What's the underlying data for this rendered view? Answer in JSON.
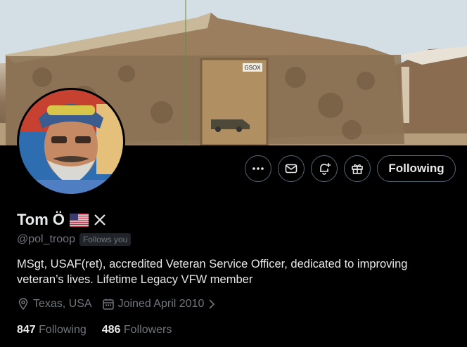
{
  "profile": {
    "name": "Tom Ö",
    "flag_icon": "us-flag-icon",
    "badge_icon": "x-logo-icon",
    "handle": "@pol_troop",
    "follows_you": "Follows you",
    "bio": "MSgt, USAF(ret), accredited Veteran Service Officer, dedicated to improving veteran’s lives. Lifetime Legacy VFW member",
    "location": "Texas, USA",
    "joined": "Joined April 2010"
  },
  "actions": {
    "more_icon": "more-icon",
    "message_icon": "message-icon",
    "notify_icon": "notification-add-icon",
    "gift_icon": "gift-icon",
    "follow_label": "Following"
  },
  "stats": {
    "following_count": "847",
    "following_label": "Following",
    "followers_count": "486",
    "followers_label": "Followers"
  },
  "banner": {
    "door_sign": "GSOX"
  },
  "colors": {
    "background": "#000000",
    "text_primary": "#e7e9ea",
    "text_secondary": "#71767b",
    "border": "#536471"
  }
}
